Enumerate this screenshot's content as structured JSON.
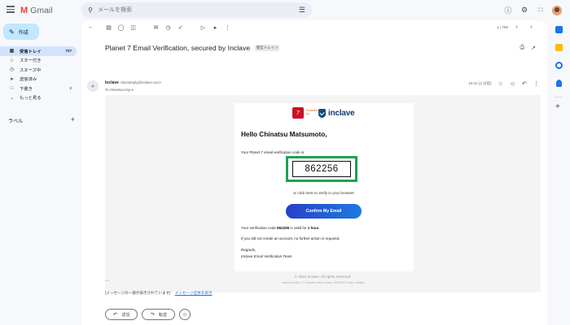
{
  "app": {
    "logo_letter": "M",
    "name": "Gmail"
  },
  "search": {
    "placeholder": "メールを検索"
  },
  "sidebar": {
    "compose_label": "作成",
    "items": [
      {
        "label": "受信トレイ",
        "count": "707",
        "icon": "inbox-icon"
      },
      {
        "label": "スター付き",
        "count": "",
        "icon": "star-icon"
      },
      {
        "label": "スヌーズ中",
        "count": "",
        "icon": "clock-icon"
      },
      {
        "label": "送信済み",
        "count": "",
        "icon": "send-icon"
      },
      {
        "label": "下書き",
        "count": "2",
        "icon": "draft-icon"
      },
      {
        "label": "もっと見る",
        "count": "",
        "icon": "chevron-down-icon"
      }
    ],
    "labels_heading": "ラベル"
  },
  "toolbar": {
    "pager": "1 / 756"
  },
  "message": {
    "subject": "Planet 7 Email Verification, secured by Inclave",
    "tag": "受信トレイ ×",
    "sender_name": "Inclave",
    "sender_email": "<donotreply@inclave.com>",
    "to": "To chinatsucomp ▾",
    "time": "10:41 (2 分前)"
  },
  "email": {
    "brand_small": "Powered by",
    "brand_name": "inclave",
    "greeting": "Hello Chinatsu Matsumoto,",
    "intro": "Your Planet 7 email verification code is:",
    "code": "862256",
    "or_click": "or click here to verify in your browser:",
    "button": "Confirm My Email",
    "valid_prefix": "Your verification code ",
    "valid_code": "862256",
    "valid_middle": " is valid for ",
    "valid_duration": "1 hour",
    "valid_suffix": ".",
    "ignore": "If you did not create an account, no further action is required.",
    "regards": "Regards,",
    "team": "Inclave Email Verification Team",
    "copyright": "© 2024 Inclave. All rights reserved.",
    "address": "Inclave Limited, 77 Camden Street Lower, D02XE80 Dublin, Ireland"
  },
  "footer": {
    "ellipsis": "...",
    "clipped_text": "[メッセージの一部が表示されています]",
    "clipped_link": "メッセージ全体を表示",
    "reply": "返信",
    "forward": "転送"
  }
}
